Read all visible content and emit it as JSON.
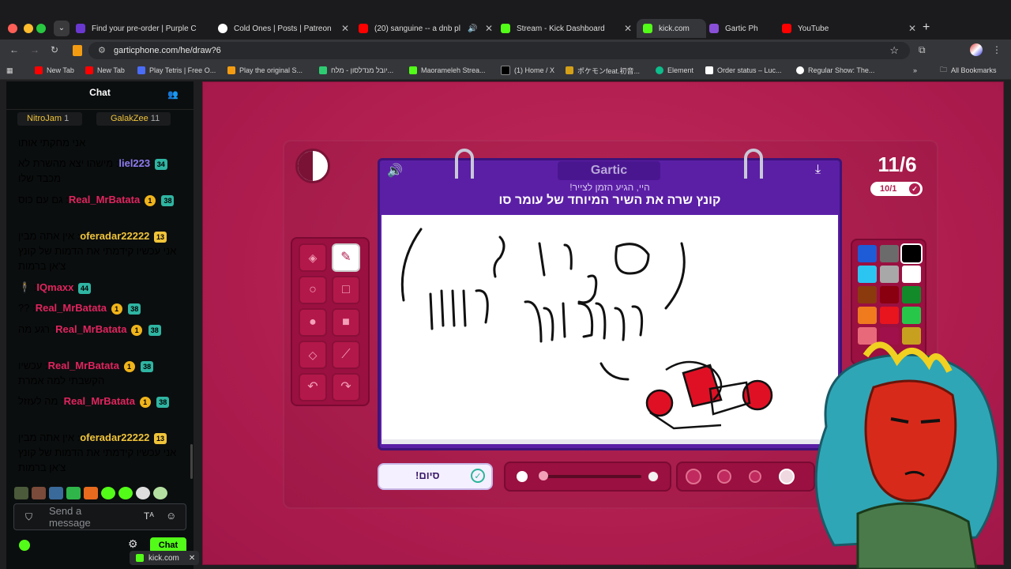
{
  "tabs": [
    {
      "title": "Find your pre-order | Purple C",
      "color": "#6a38d0"
    },
    {
      "title": "Cold Ones | Posts | Patreon",
      "color": "#ffffff"
    },
    {
      "title": "(20) sanguine -- a dnb pl",
      "color": "#ff0000"
    },
    {
      "title": "Stream - Kick Dashboard",
      "color": "#53fc18"
    },
    {
      "title": "kick.com",
      "color": "#53fc18"
    },
    {
      "title": "Gartic Ph",
      "color": "#8a4fd8"
    },
    {
      "title": "YouTube",
      "color": "#ff0000"
    }
  ],
  "address": "garticphone.com/he/draw?6",
  "bookmarks": [
    {
      "label": "New Tab",
      "color": "#ff0000"
    },
    {
      "label": "New Tab",
      "color": "#ff0000"
    },
    {
      "label": "Play Tetris | Free O...",
      "color": "#4a6cf7"
    },
    {
      "label": "Play the original S...",
      "color": "#f39c12"
    },
    {
      "label": "יובל מנדלסון - מלח...",
      "color": "#2ecc71"
    },
    {
      "label": "Maorameleh Strea...",
      "color": "#53fc18"
    },
    {
      "label": "(1) Home / X",
      "color": "#000000"
    },
    {
      "label": "ポケモンfeat.初音...",
      "color": "#d4a017"
    },
    {
      "label": "Element",
      "color": "#0dbd8b"
    },
    {
      "label": "Order status – Luc...",
      "color": "#ffffff"
    },
    {
      "label": "Regular Show: The...",
      "color": "#ffffff"
    }
  ],
  "all_bookmarks": "All Bookmarks",
  "chat": {
    "title": "Chat",
    "gifters": [
      {
        "name": "NitroJam",
        "count": "1"
      },
      {
        "name": "GalakZee",
        "count": "11"
      }
    ],
    "messages": [
      {
        "user": "",
        "badges": [],
        "text": "אני מחקתי אותו",
        "color": "#ffffff"
      },
      {
        "user": "liel223",
        "badges": [
          "34"
        ],
        "text": "מישהו יצא מהשרת לא מכבד שלו",
        "color": "#8e7cf0"
      },
      {
        "user": "Real_MrBatata",
        "badges": [
          "38",
          "1"
        ],
        "text": "גם עם כוס",
        "color": "#e0245e"
      },
      {
        "user": "oferadar22222",
        "badges": [
          "13"
        ],
        "text": "אין אתה מבין אני עכשיו קידמתי את הדמות של קונץ צ'אן ברמות",
        "color": "#f0c43a"
      },
      {
        "user": "IQmaxx",
        "badges": [
          "44"
        ],
        "text": "",
        "color": "#e0245e"
      },
      {
        "user": "Real_MrBatata",
        "badges": [
          "38",
          "1"
        ],
        "text": "??",
        "color": "#e0245e"
      },
      {
        "user": "Real_MrBatata",
        "badges": [
          "38",
          "1"
        ],
        "text": "רגע מה",
        "color": "#e0245e"
      },
      {
        "user": "Real_MrBatata",
        "badges": [
          "38",
          "1"
        ],
        "text": "עכשיו הקשבתי למה אמרת",
        "color": "#e0245e"
      },
      {
        "user": "Real_MrBatata",
        "badges": [
          "38",
          "1"
        ],
        "text": "מה לעזזל",
        "color": "#e0245e"
      },
      {
        "user": "oferadar22222",
        "badges": [
          "13"
        ],
        "text": "אין אתה מבין אני עכשיו קידמתי את הדמות של קונץ צ'אן ברמות",
        "color": "#f0c43a"
      }
    ],
    "input_placeholder": "Send a message",
    "send_label": "Chat",
    "popup_label": "kick.com"
  },
  "game": {
    "logo": "Gartic",
    "subtitle": "היי, הגיע הזמן לצייר!",
    "prompt": "קונץ שרה את השיר המיוחד של עומר סו",
    "round": "11/6",
    "done_count": "10/1",
    "done_button": "סיום!",
    "colors": [
      "#1e5bd6",
      "#6b6b6b",
      "#000000",
      "#2cc5f2",
      "#a8a8a8",
      "#ffffff",
      "#8b3a0e",
      "#8a0010",
      "#128a2a",
      "#f07a1e",
      "#e8141e",
      "#27c84a",
      "#e86a7a",
      "#a0104a",
      "#c8a020"
    ]
  }
}
